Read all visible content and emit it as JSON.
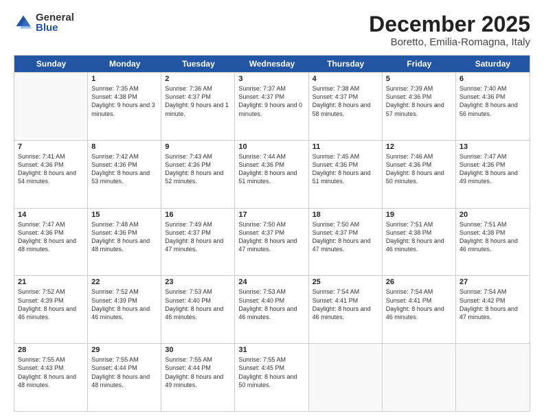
{
  "logo": {
    "general": "General",
    "blue": "Blue"
  },
  "title": "December 2025",
  "subtitle": "Boretto, Emilia-Romagna, Italy",
  "header_days": [
    "Sunday",
    "Monday",
    "Tuesday",
    "Wednesday",
    "Thursday",
    "Friday",
    "Saturday"
  ],
  "weeks": [
    [
      {
        "day": "",
        "sunrise": "",
        "sunset": "",
        "daylight": "",
        "empty": true
      },
      {
        "day": "1",
        "sunrise": "Sunrise: 7:35 AM",
        "sunset": "Sunset: 4:38 PM",
        "daylight": "Daylight: 9 hours and 3 minutes."
      },
      {
        "day": "2",
        "sunrise": "Sunrise: 7:36 AM",
        "sunset": "Sunset: 4:37 PM",
        "daylight": "Daylight: 9 hours and 1 minute."
      },
      {
        "day": "3",
        "sunrise": "Sunrise: 7:37 AM",
        "sunset": "Sunset: 4:37 PM",
        "daylight": "Daylight: 9 hours and 0 minutes."
      },
      {
        "day": "4",
        "sunrise": "Sunrise: 7:38 AM",
        "sunset": "Sunset: 4:37 PM",
        "daylight": "Daylight: 8 hours and 58 minutes."
      },
      {
        "day": "5",
        "sunrise": "Sunrise: 7:39 AM",
        "sunset": "Sunset: 4:36 PM",
        "daylight": "Daylight: 8 hours and 57 minutes."
      },
      {
        "day": "6",
        "sunrise": "Sunrise: 7:40 AM",
        "sunset": "Sunset: 4:36 PM",
        "daylight": "Daylight: 8 hours and 56 minutes."
      }
    ],
    [
      {
        "day": "7",
        "sunrise": "Sunrise: 7:41 AM",
        "sunset": "Sunset: 4:36 PM",
        "daylight": "Daylight: 8 hours and 54 minutes."
      },
      {
        "day": "8",
        "sunrise": "Sunrise: 7:42 AM",
        "sunset": "Sunset: 4:36 PM",
        "daylight": "Daylight: 8 hours and 53 minutes."
      },
      {
        "day": "9",
        "sunrise": "Sunrise: 7:43 AM",
        "sunset": "Sunset: 4:36 PM",
        "daylight": "Daylight: 8 hours and 52 minutes."
      },
      {
        "day": "10",
        "sunrise": "Sunrise: 7:44 AM",
        "sunset": "Sunset: 4:36 PM",
        "daylight": "Daylight: 8 hours and 51 minutes."
      },
      {
        "day": "11",
        "sunrise": "Sunrise: 7:45 AM",
        "sunset": "Sunset: 4:36 PM",
        "daylight": "Daylight: 8 hours and 51 minutes."
      },
      {
        "day": "12",
        "sunrise": "Sunrise: 7:46 AM",
        "sunset": "Sunset: 4:36 PM",
        "daylight": "Daylight: 8 hours and 50 minutes."
      },
      {
        "day": "13",
        "sunrise": "Sunrise: 7:47 AM",
        "sunset": "Sunset: 4:36 PM",
        "daylight": "Daylight: 8 hours and 49 minutes."
      }
    ],
    [
      {
        "day": "14",
        "sunrise": "Sunrise: 7:47 AM",
        "sunset": "Sunset: 4:36 PM",
        "daylight": "Daylight: 8 hours and 48 minutes."
      },
      {
        "day": "15",
        "sunrise": "Sunrise: 7:48 AM",
        "sunset": "Sunset: 4:36 PM",
        "daylight": "Daylight: 8 hours and 48 minutes."
      },
      {
        "day": "16",
        "sunrise": "Sunrise: 7:49 AM",
        "sunset": "Sunset: 4:37 PM",
        "daylight": "Daylight: 8 hours and 47 minutes."
      },
      {
        "day": "17",
        "sunrise": "Sunrise: 7:50 AM",
        "sunset": "Sunset: 4:37 PM",
        "daylight": "Daylight: 8 hours and 47 minutes."
      },
      {
        "day": "18",
        "sunrise": "Sunrise: 7:50 AM",
        "sunset": "Sunset: 4:37 PM",
        "daylight": "Daylight: 8 hours and 47 minutes."
      },
      {
        "day": "19",
        "sunrise": "Sunrise: 7:51 AM",
        "sunset": "Sunset: 4:38 PM",
        "daylight": "Daylight: 8 hours and 46 minutes."
      },
      {
        "day": "20",
        "sunrise": "Sunrise: 7:51 AM",
        "sunset": "Sunset: 4:38 PM",
        "daylight": "Daylight: 8 hours and 46 minutes."
      }
    ],
    [
      {
        "day": "21",
        "sunrise": "Sunrise: 7:52 AM",
        "sunset": "Sunset: 4:39 PM",
        "daylight": "Daylight: 8 hours and 46 minutes."
      },
      {
        "day": "22",
        "sunrise": "Sunrise: 7:52 AM",
        "sunset": "Sunset: 4:39 PM",
        "daylight": "Daylight: 8 hours and 46 minutes."
      },
      {
        "day": "23",
        "sunrise": "Sunrise: 7:53 AM",
        "sunset": "Sunset: 4:40 PM",
        "daylight": "Daylight: 8 hours and 46 minutes."
      },
      {
        "day": "24",
        "sunrise": "Sunrise: 7:53 AM",
        "sunset": "Sunset: 4:40 PM",
        "daylight": "Daylight: 8 hours and 46 minutes."
      },
      {
        "day": "25",
        "sunrise": "Sunrise: 7:54 AM",
        "sunset": "Sunset: 4:41 PM",
        "daylight": "Daylight: 8 hours and 46 minutes."
      },
      {
        "day": "26",
        "sunrise": "Sunrise: 7:54 AM",
        "sunset": "Sunset: 4:41 PM",
        "daylight": "Daylight: 8 hours and 46 minutes."
      },
      {
        "day": "27",
        "sunrise": "Sunrise: 7:54 AM",
        "sunset": "Sunset: 4:42 PM",
        "daylight": "Daylight: 8 hours and 47 minutes."
      }
    ],
    [
      {
        "day": "28",
        "sunrise": "Sunrise: 7:55 AM",
        "sunset": "Sunset: 4:43 PM",
        "daylight": "Daylight: 8 hours and 48 minutes."
      },
      {
        "day": "29",
        "sunrise": "Sunrise: 7:55 AM",
        "sunset": "Sunset: 4:44 PM",
        "daylight": "Daylight: 8 hours and 48 minutes."
      },
      {
        "day": "30",
        "sunrise": "Sunrise: 7:55 AM",
        "sunset": "Sunset: 4:44 PM",
        "daylight": "Daylight: 8 hours and 49 minutes."
      },
      {
        "day": "31",
        "sunrise": "Sunrise: 7:55 AM",
        "sunset": "Sunset: 4:45 PM",
        "daylight": "Daylight: 8 hours and 50 minutes."
      },
      {
        "day": "",
        "sunrise": "",
        "sunset": "",
        "daylight": "",
        "empty": true
      },
      {
        "day": "",
        "sunrise": "",
        "sunset": "",
        "daylight": "",
        "empty": true
      },
      {
        "day": "",
        "sunrise": "",
        "sunset": "",
        "daylight": "",
        "empty": true
      }
    ]
  ]
}
